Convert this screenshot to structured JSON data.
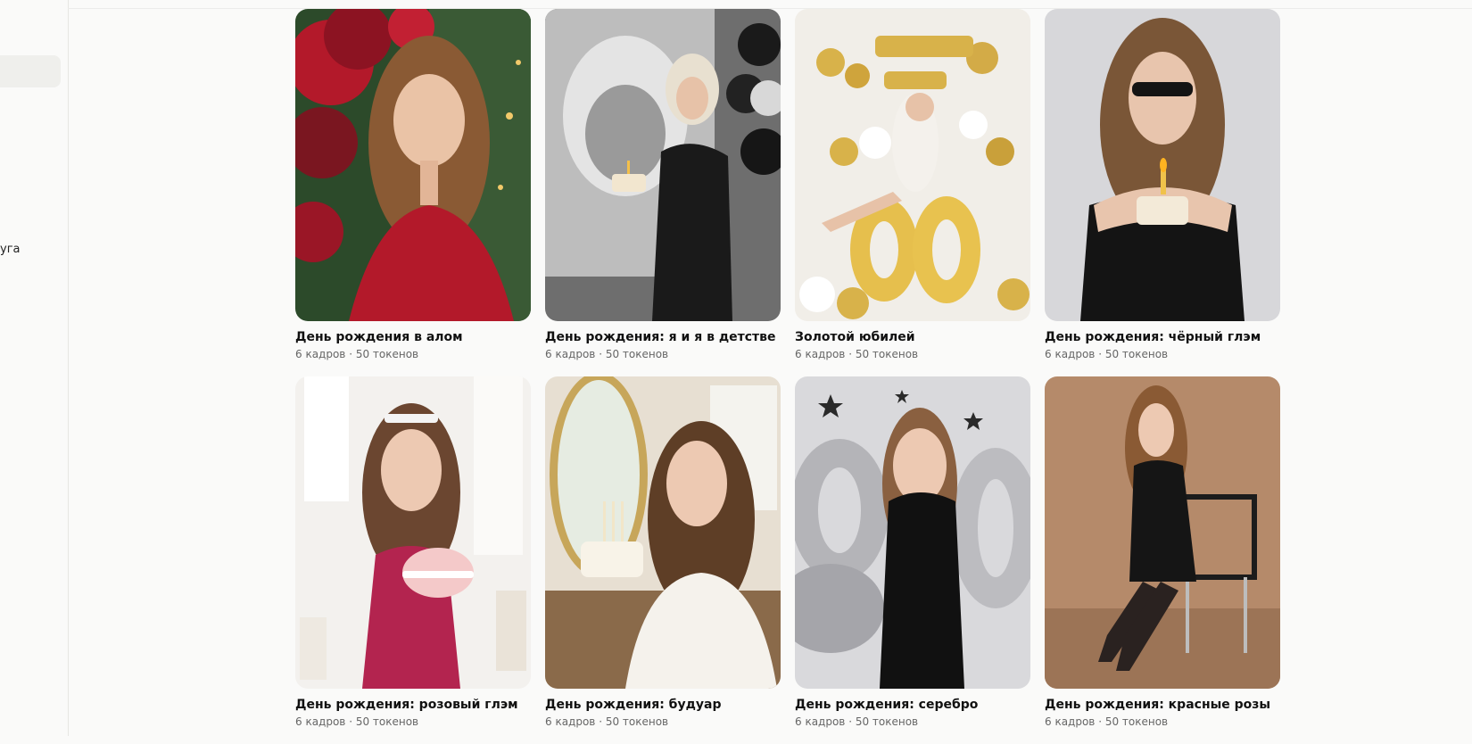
{
  "sidebar": {
    "partial_label": "уга"
  },
  "cards": [
    {
      "title": "День рождения в алом",
      "meta": "6 кадров · 50 токенов",
      "scene": "red-balloons-woman-red-dress",
      "colors": {
        "bg": "#7a1620",
        "accent": "#b3192a",
        "bg2": "#2c4a2a"
      }
    },
    {
      "title": "День рождения: я и я в детстве",
      "meta": "6 кадров · 50 токенов",
      "scene": "black-white-child-portrait-woman-cake",
      "colors": {
        "bg": "#cfcfcf",
        "accent": "#1a1a1a",
        "bg2": "#8a8a8a"
      }
    },
    {
      "title": "Золотой юбилей",
      "meta": "6 кадров · 50 токенов",
      "scene": "gold-balloons-30-happy-bday",
      "colors": {
        "bg": "#f1eee8",
        "accent": "#d8b24a",
        "bg2": "#ffffff"
      }
    },
    {
      "title": "День рождения: чёрный глэм",
      "meta": "6 кадров · 50 токенов",
      "scene": "woman-sunglasses-black-dress-cake",
      "colors": {
        "bg": "#d7d7da",
        "accent": "#141414",
        "bg2": "#c9c9cc"
      }
    },
    {
      "title": "День рождения: розовый глэм",
      "meta": "6 кадров · 50 токенов",
      "scene": "woman-pink-dress-pink-cake-25",
      "colors": {
        "bg": "#f3f1ee",
        "accent": "#b3244f",
        "bg2": "#f4c9c9"
      }
    },
    {
      "title": "День рождения: будуар",
      "meta": "6 кадров · 50 токенов",
      "scene": "woman-lace-top-cake-candles",
      "colors": {
        "bg": "#e7dfd2",
        "accent": "#f5f2ec",
        "bg2": "#8a6a4a"
      }
    },
    {
      "title": "День рождения: серебро",
      "meta": "6 кадров · 50 токенов",
      "scene": "silver-balloons-24-sequin-dress",
      "colors": {
        "bg": "#d9d9dc",
        "accent": "#111111",
        "bg2": "#a9a9ad"
      }
    },
    {
      "title": "День рождения: красные розы",
      "meta": "6 кадров · 50 токенов",
      "scene": "woman-black-blazer-chair-brown-backdrop",
      "colors": {
        "bg": "#b58a6a",
        "accent": "#151515",
        "bg2": "#9c7456"
      }
    }
  ]
}
